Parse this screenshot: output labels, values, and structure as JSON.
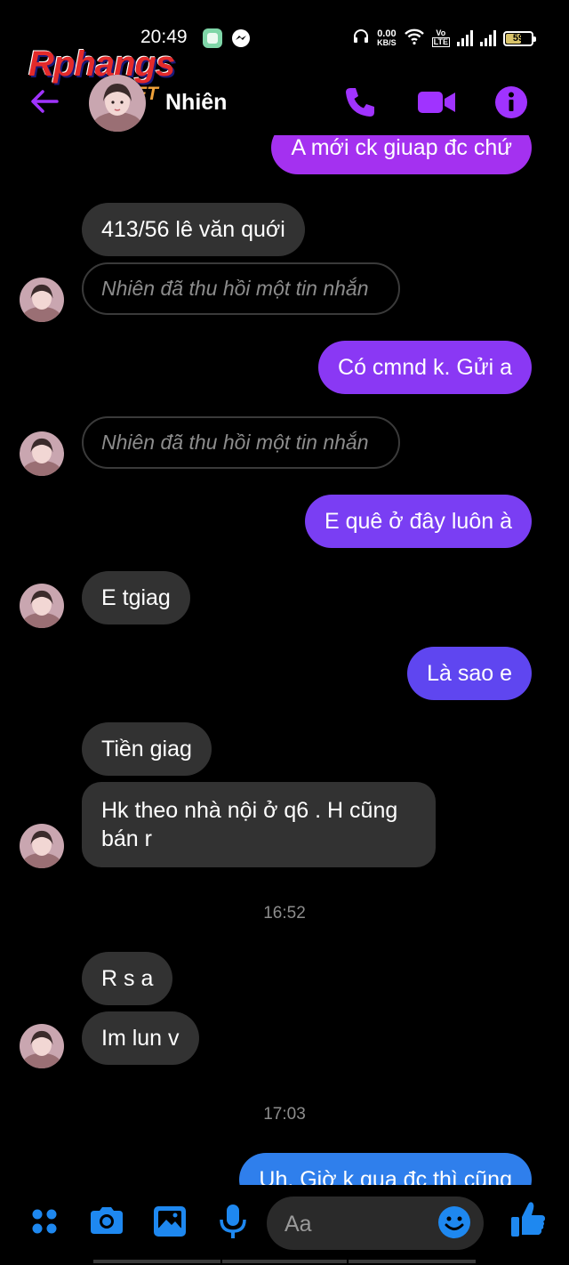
{
  "status_bar": {
    "time": "20:49",
    "net_speed_value": "0.00",
    "net_speed_unit": "KB/S",
    "volte_top": "Vo",
    "volte_bottom": "LTE",
    "battery_level": "59",
    "icons": [
      "app-icon",
      "messenger-icon",
      "headset-icon",
      "wifi-icon",
      "signal-icon",
      "signal-icon",
      "battery-icon"
    ]
  },
  "watermark": {
    "main": "Rphangs",
    "sub": ".NET"
  },
  "header": {
    "contact_name": "Nhiên",
    "actions": [
      "back-icon",
      "phone-icon",
      "video-icon",
      "info-icon"
    ],
    "accent_color": "#a033ff"
  },
  "messages": {
    "m1": "A mới ck giuap đc chứ",
    "m2": "413/56 lê văn quới",
    "m3": "Nhiên đã thu hồi một tin nhắn",
    "m4": "Có cmnd k. Gửi a",
    "m5": "Nhiên đã thu hồi một tin nhắn",
    "m6": "E quê ở đây luôn à",
    "m7": "E tgiag",
    "m8": "Là sao e",
    "m9": "Tiền giag",
    "m10_line1": "Hk theo nhà nội ở q6 . H cũng",
    "m10_line2": "bán r",
    "ts1": "16:52",
    "m11": "R s a",
    "m12": "Im lun v",
    "ts2": "17:03",
    "m13": "Uh. Giờ k qua đc thì cũng"
  },
  "colors": {
    "outgoing_1": "#a431f0",
    "outgoing_2": "#8a38f4",
    "outgoing_3": "#7a3ef3",
    "outgoing_4": "#5f46f0",
    "outgoing_5": "#2f7fec",
    "incoming": "#323232"
  },
  "composer": {
    "placeholder": "Aa",
    "icons": [
      "menu-dots-icon",
      "camera-icon",
      "gallery-icon",
      "microphone-icon",
      "emoji-icon",
      "thumbs-up-icon"
    ]
  }
}
